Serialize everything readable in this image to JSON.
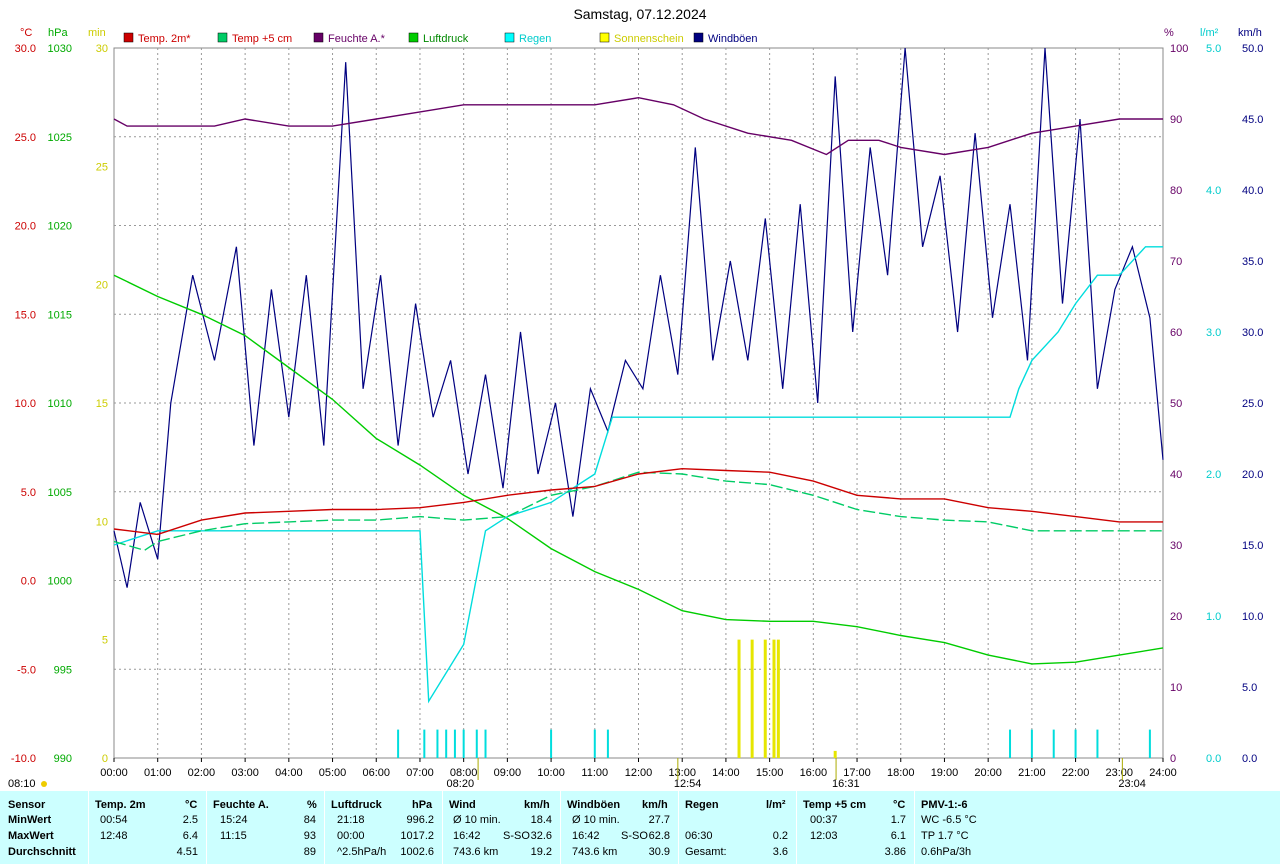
{
  "title": "Samstag, 07.12.2024",
  "units": {
    "temp": "°C",
    "pressure": "hPa",
    "sunshine": "min",
    "humidity": "%",
    "rain": "l/m²",
    "wind": "km/h"
  },
  "colors": {
    "temp2m": "#cc0000",
    "temp5cm": "#00cc66",
    "humidity": "#660066",
    "pressure": "#00cc00",
    "rain": "#00dddd",
    "sunshine": "#e6e600",
    "gusts": "#000080"
  },
  "legend": [
    {
      "label": "Temp. 2m*",
      "color": "#cc0000",
      "textColor": "#cc0000"
    },
    {
      "label": "Temp +5 cm",
      "color": "#00cc66",
      "textColor": "#cc0000"
    },
    {
      "label": "Feuchte A.*",
      "color": "#660066",
      "textColor": "#660066"
    },
    {
      "label": "Luftdruck",
      "color": "#00cc00",
      "textColor": "#008800"
    },
    {
      "label": "Regen",
      "color": "#00ffff",
      "textColor": "#00cccc"
    },
    {
      "label": "Sonnenschein",
      "color": "#ffff00",
      "textColor": "#cccc00"
    },
    {
      "label": "Windböen",
      "color": "#000080",
      "textColor": "#000080"
    }
  ],
  "axes": {
    "temp": {
      "ticks": [
        "30.0",
        "25.0",
        "20.0",
        "15.0",
        "10.0",
        "5.0",
        "0.0",
        "-5.0",
        "-10.0"
      ]
    },
    "pressure": {
      "ticks": [
        "1030",
        "1025",
        "1020",
        "1015",
        "1010",
        "1005",
        "1000",
        "995",
        "990"
      ]
    },
    "sunshine": {
      "ticks": [
        "30",
        "25",
        "20",
        "15",
        "10",
        "5",
        "0"
      ]
    },
    "humidity": {
      "ticks": [
        "100",
        "90",
        "80",
        "70",
        "60",
        "50",
        "40",
        "30",
        "20",
        "10",
        "0"
      ]
    },
    "rain": {
      "ticks": [
        "5.0",
        "4.0",
        "3.0",
        "2.0",
        "1.0",
        "0.0"
      ]
    },
    "wind": {
      "ticks": [
        "50.0",
        "45.0",
        "40.0",
        "35.0",
        "30.0",
        "25.0",
        "20.0",
        "15.0",
        "10.0",
        "5.0",
        "0.0"
      ]
    },
    "x": {
      "ticks": [
        "00:00",
        "01:00",
        "02:00",
        "03:00",
        "04:00",
        "05:00",
        "06:00",
        "07:00",
        "08:00",
        "09:00",
        "10:00",
        "11:00",
        "12:00",
        "13:00",
        "14:00",
        "15:00",
        "16:00",
        "17:00",
        "18:00",
        "19:00",
        "20:00",
        "21:00",
        "22:00",
        "23:00",
        "24:00"
      ]
    }
  },
  "sun_markers": [
    {
      "label": "08:10",
      "hour": 8.17
    },
    {
      "label": "08:20",
      "hour": 8.33
    },
    {
      "label": "12:54",
      "hour": 12.9
    },
    {
      "label": "16:31",
      "hour": 16.52
    },
    {
      "label": "23:04",
      "hour": 23.07
    }
  ],
  "chart_data": {
    "type": "line",
    "title": "Samstag, 07.12.2024",
    "xlim": [
      0,
      24
    ],
    "series": [
      {
        "name": "Temp. 2m*",
        "axis": "temp",
        "points": [
          [
            0,
            2.9
          ],
          [
            1,
            2.6
          ],
          [
            2,
            3.4
          ],
          [
            3,
            3.8
          ],
          [
            4,
            3.9
          ],
          [
            5,
            4.0
          ],
          [
            6,
            4.0
          ],
          [
            7,
            4.1
          ],
          [
            8,
            4.4
          ],
          [
            9,
            4.8
          ],
          [
            10,
            5.1
          ],
          [
            11,
            5.3
          ],
          [
            12,
            6.0
          ],
          [
            13,
            6.3
          ],
          [
            14,
            6.2
          ],
          [
            15,
            6.1
          ],
          [
            16,
            5.6
          ],
          [
            17,
            4.8
          ],
          [
            18,
            4.6
          ],
          [
            19,
            4.6
          ],
          [
            20,
            4.1
          ],
          [
            21,
            3.9
          ],
          [
            22,
            3.6
          ],
          [
            23,
            3.3
          ],
          [
            24,
            3.3
          ]
        ]
      },
      {
        "name": "Temp +5 cm",
        "axis": "temp",
        "points": [
          [
            0,
            2.2
          ],
          [
            0.7,
            1.7
          ],
          [
            1,
            2.2
          ],
          [
            2,
            2.8
          ],
          [
            3,
            3.2
          ],
          [
            4,
            3.3
          ],
          [
            5,
            3.4
          ],
          [
            6,
            3.4
          ],
          [
            7,
            3.6
          ],
          [
            8,
            3.4
          ],
          [
            9,
            3.6
          ],
          [
            10,
            4.8
          ],
          [
            11,
            5.3
          ],
          [
            12,
            6.1
          ],
          [
            13,
            6.0
          ],
          [
            14,
            5.6
          ],
          [
            15,
            5.4
          ],
          [
            16,
            4.8
          ],
          [
            17,
            4.0
          ],
          [
            18,
            3.6
          ],
          [
            19,
            3.4
          ],
          [
            20,
            3.3
          ],
          [
            21,
            2.8
          ],
          [
            22,
            2.8
          ],
          [
            23,
            2.8
          ],
          [
            24,
            2.8
          ]
        ]
      },
      {
        "name": "Feuchte A.*",
        "axis": "humidity",
        "points": [
          [
            0,
            90
          ],
          [
            0.3,
            89
          ],
          [
            1,
            89
          ],
          [
            2,
            89
          ],
          [
            2.3,
            89
          ],
          [
            3,
            90
          ],
          [
            4,
            89
          ],
          [
            5,
            89
          ],
          [
            6,
            90
          ],
          [
            7,
            91
          ],
          [
            8,
            92
          ],
          [
            9,
            92
          ],
          [
            10,
            92
          ],
          [
            11,
            92
          ],
          [
            12,
            93
          ],
          [
            12.8,
            92
          ],
          [
            13.5,
            90
          ],
          [
            14.5,
            88
          ],
          [
            15.5,
            87
          ],
          [
            16.3,
            85
          ],
          [
            16.8,
            87
          ],
          [
            17.5,
            87
          ],
          [
            18,
            86
          ],
          [
            19,
            85
          ],
          [
            20,
            86
          ],
          [
            21,
            88
          ],
          [
            22,
            89
          ],
          [
            23,
            90
          ],
          [
            24,
            90
          ]
        ]
      },
      {
        "name": "Luftdruck",
        "axis": "pressure",
        "points": [
          [
            0,
            1017.2
          ],
          [
            1,
            1016.0
          ],
          [
            2,
            1015.0
          ],
          [
            3,
            1013.8
          ],
          [
            4,
            1012.0
          ],
          [
            5,
            1010.2
          ],
          [
            6,
            1008.0
          ],
          [
            7,
            1006.5
          ],
          [
            8,
            1004.8
          ],
          [
            9,
            1003.5
          ],
          [
            10,
            1001.8
          ],
          [
            11,
            1000.5
          ],
          [
            12,
            999.5
          ],
          [
            13,
            998.3
          ],
          [
            14,
            997.8
          ],
          [
            15,
            997.7
          ],
          [
            16,
            997.7
          ],
          [
            17,
            997.4
          ],
          [
            18,
            996.9
          ],
          [
            19,
            996.5
          ],
          [
            20,
            995.8
          ],
          [
            21,
            995.3
          ],
          [
            22,
            995.4
          ],
          [
            23,
            995.8
          ],
          [
            24,
            996.2
          ]
        ]
      },
      {
        "name": "Regen",
        "axis": "rain",
        "points": [
          [
            0,
            1.5
          ],
          [
            1,
            1.6
          ],
          [
            7,
            1.6
          ],
          [
            7.2,
            0.4
          ],
          [
            8,
            0.8
          ],
          [
            8.5,
            1.6
          ],
          [
            9,
            1.7
          ],
          [
            10,
            1.8
          ],
          [
            10.5,
            1.9
          ],
          [
            11,
            2.0
          ],
          [
            11.4,
            2.4
          ],
          [
            12,
            2.4
          ],
          [
            13,
            2.4
          ],
          [
            19,
            2.4
          ],
          [
            20.5,
            2.4
          ],
          [
            20.7,
            2.6
          ],
          [
            21,
            2.8
          ],
          [
            21.6,
            3.0
          ],
          [
            22,
            3.2
          ],
          [
            22.5,
            3.4
          ],
          [
            23,
            3.4
          ],
          [
            23.6,
            3.6
          ],
          [
            24,
            3.6
          ]
        ]
      },
      {
        "name": "Windböen",
        "axis": "wind",
        "points": [
          [
            0,
            16
          ],
          [
            0.3,
            12
          ],
          [
            0.6,
            18
          ],
          [
            1,
            14
          ],
          [
            1.3,
            25
          ],
          [
            1.8,
            34
          ],
          [
            2.3,
            28
          ],
          [
            2.8,
            36
          ],
          [
            3.2,
            22
          ],
          [
            3.6,
            33
          ],
          [
            4.0,
            24
          ],
          [
            4.4,
            34
          ],
          [
            4.8,
            22
          ],
          [
            5.3,
            49
          ],
          [
            5.7,
            26
          ],
          [
            6.1,
            34
          ],
          [
            6.5,
            22
          ],
          [
            6.9,
            32
          ],
          [
            7.3,
            24
          ],
          [
            7.7,
            28
          ],
          [
            8.1,
            20
          ],
          [
            8.5,
            27
          ],
          [
            8.9,
            19
          ],
          [
            9.3,
            30
          ],
          [
            9.7,
            20
          ],
          [
            10.1,
            25
          ],
          [
            10.5,
            17
          ],
          [
            10.9,
            26
          ],
          [
            11.3,
            23
          ],
          [
            11.7,
            28
          ],
          [
            12.1,
            26
          ],
          [
            12.5,
            34
          ],
          [
            12.9,
            27
          ],
          [
            13.3,
            43
          ],
          [
            13.7,
            28
          ],
          [
            14.1,
            35
          ],
          [
            14.5,
            28
          ],
          [
            14.9,
            38
          ],
          [
            15.3,
            26
          ],
          [
            15.7,
            39
          ],
          [
            16.1,
            25
          ],
          [
            16.5,
            48
          ],
          [
            16.9,
            30
          ],
          [
            17.3,
            43
          ],
          [
            17.7,
            34
          ],
          [
            18.1,
            50
          ],
          [
            18.5,
            36
          ],
          [
            18.9,
            41
          ],
          [
            19.3,
            30
          ],
          [
            19.7,
            44
          ],
          [
            20.1,
            31
          ],
          [
            20.5,
            39
          ],
          [
            20.9,
            28
          ],
          [
            21.3,
            50
          ],
          [
            21.7,
            32
          ],
          [
            22.1,
            45
          ],
          [
            22.5,
            26
          ],
          [
            22.9,
            33
          ],
          [
            23.3,
            36
          ],
          [
            23.7,
            31
          ],
          [
            24,
            21
          ]
        ]
      }
    ],
    "sunshine_bars": [
      [
        14.3,
        5
      ],
      [
        14.6,
        5
      ],
      [
        14.9,
        5
      ],
      [
        15.1,
        5
      ],
      [
        15.2,
        5
      ],
      [
        16.5,
        0.3
      ]
    ],
    "rain_bars": [
      [
        6.5,
        0.2
      ],
      [
        7.1,
        0.2
      ],
      [
        7.4,
        0.2
      ],
      [
        7.6,
        0.2
      ],
      [
        7.8,
        0.2
      ],
      [
        8.0,
        0.2
      ],
      [
        8.3,
        0.2
      ],
      [
        8.5,
        0.2
      ],
      [
        10.0,
        0.2
      ],
      [
        11.0,
        0.2
      ],
      [
        11.3,
        0.2
      ],
      [
        20.5,
        0.2
      ],
      [
        21.0,
        0.2
      ],
      [
        21.5,
        0.2
      ],
      [
        22.0,
        0.2
      ],
      [
        22.5,
        0.2
      ],
      [
        23.7,
        0.2
      ]
    ],
    "axis_ranges": {
      "temp": [
        -10,
        30
      ],
      "pressure": [
        990,
        1030
      ],
      "sunshine": [
        0,
        30
      ],
      "humidity": [
        0,
        100
      ],
      "rain": [
        0,
        5
      ],
      "wind": [
        0,
        50
      ]
    },
    "grid": true
  },
  "stats": {
    "headers": {
      "sensor": "Sensor",
      "temp": "Temp. 2m",
      "temp_unit": "°C",
      "hum": "Feuchte A.",
      "hum_unit": "%",
      "press": "Luftdruck",
      "press_unit": "hPa",
      "wind": "Wind",
      "wind_unit": "km/h",
      "gust": "Windböen",
      "gust_unit": "km/h",
      "rain": "Regen",
      "rain_unit": "l/m²",
      "t5": "Temp +5 cm",
      "t5_unit": "°C",
      "pmv": "PMV-1:-6"
    },
    "rows": {
      "min": {
        "label": "MinWert",
        "temp_t": "00:54",
        "temp_v": "2.5",
        "hum_t": "15:24",
        "hum_v": "84",
        "press_t": "21:18",
        "press_v": "996.2",
        "wind_t": "Ø 10 min.",
        "wind_v": "18.4",
        "gust_t": "Ø 10 min.",
        "gust_v": "27.7",
        "rain_t": "",
        "rain_v": "",
        "t5_t": "00:37",
        "t5_v": "1.7",
        "pmv": "WC -6.5 °C"
      },
      "max": {
        "label": "MaxWert",
        "temp_t": "12:48",
        "temp_v": "6.4",
        "hum_t": "11:15",
        "hum_v": "93",
        "press_t": "00:00",
        "press_v": "1017.2",
        "wind_t": "16:42",
        "wind_d": "S-SO",
        "wind_v": "32.6",
        "gust_t": "16:42",
        "gust_d": "S-SO",
        "gust_v": "62.8",
        "rain_t": "06:30",
        "rain_v": "0.2",
        "t5_t": "12:03",
        "t5_v": "6.1",
        "pmv": "TP 1.7 °C"
      },
      "avg": {
        "label": "Durchschnitt",
        "temp_t": "",
        "temp_v": "4.51",
        "hum_t": "",
        "hum_v": "89",
        "press_t": "^2.5hPa/h",
        "press_v": "1002.6",
        "wind_t": "743.6 km",
        "wind_v": "19.2",
        "gust_t": "743.6 km",
        "gust_v": "30.9",
        "rain_t": "Gesamt:",
        "rain_v": "3.6",
        "t5_t": "",
        "t5_v": "3.86",
        "pmv": "0.6hPa/3h"
      }
    }
  }
}
